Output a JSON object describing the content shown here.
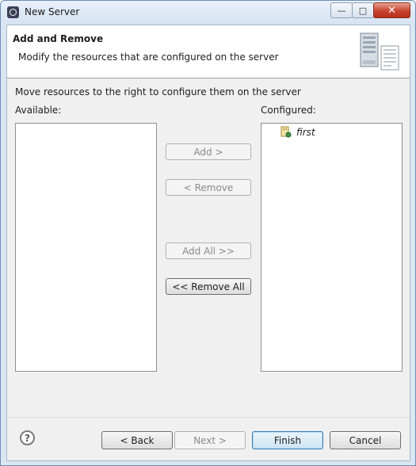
{
  "window": {
    "title": "New Server",
    "minimize_glyph": "—",
    "maximize_glyph": "□",
    "close_glyph": "✕"
  },
  "banner": {
    "title": "Add and Remove",
    "description": "Modify the resources that are configured on the server"
  },
  "instructions": "Move resources to the right to configure them on the server",
  "available": {
    "label": "Available:",
    "items": []
  },
  "configured": {
    "label": "Configured:",
    "items": [
      {
        "label": "first",
        "icon": "project-module-icon"
      }
    ]
  },
  "buttons": {
    "add": "Add >",
    "remove": "< Remove",
    "add_all": "Add All >>",
    "remove_all": "<< Remove All",
    "back": "< Back",
    "next": "Next >",
    "finish": "Finish",
    "cancel": "Cancel",
    "help": "?"
  },
  "colors": {
    "accent_border": "#3c7fb1",
    "close_button": "#c7432f"
  }
}
